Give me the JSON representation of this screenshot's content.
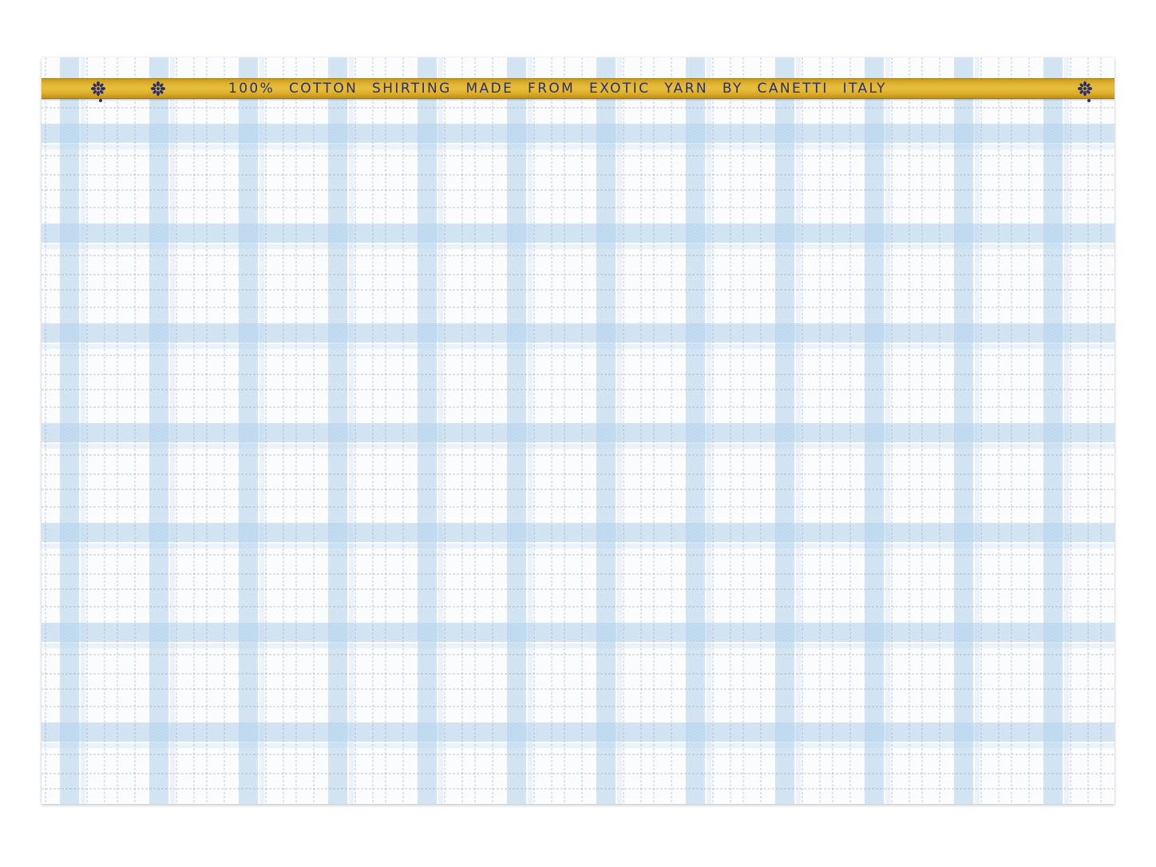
{
  "selvedge": {
    "text": "100% COTTON SHIRTING MADE FROM EXOTIC YARN BY CANETTI ITALY",
    "color": "#e2b635",
    "text_color": "#2a2f6e",
    "ornament_icon": "flower-ornament-icon"
  },
  "fabric": {
    "pattern": "blue-check",
    "base_color": "#fbfcfd",
    "band_color": "#a9cff0",
    "thread_color": "#8a90b8"
  }
}
